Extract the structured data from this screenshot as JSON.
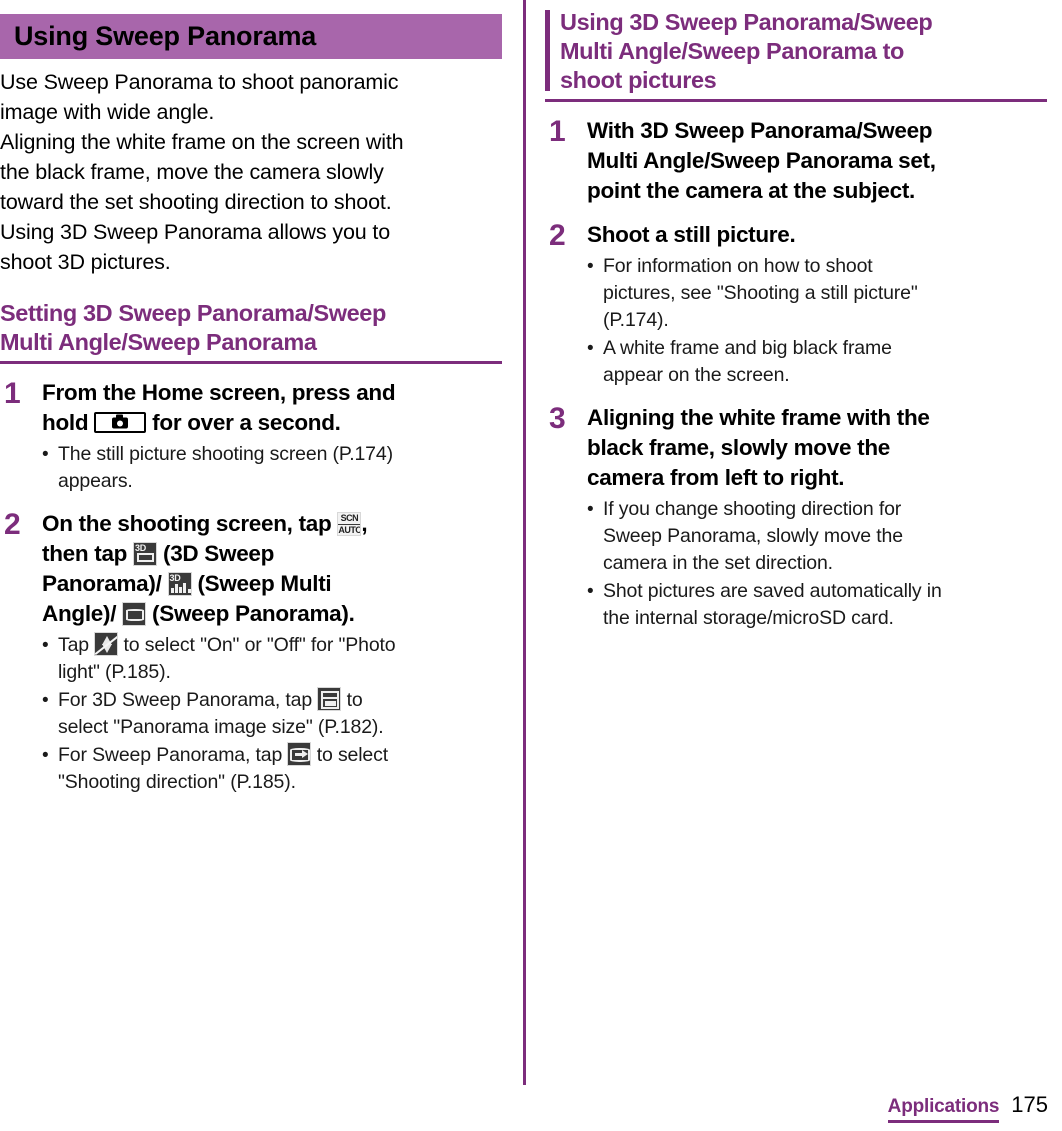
{
  "page": {
    "number": "175",
    "section_tag": "Applications"
  },
  "colors": {
    "header_bar": "#a866ab",
    "heading_purple": "#7c2d7c",
    "text": "#000000"
  },
  "left_column": {
    "title_bar": {
      "label": "Using Sweep Panorama"
    },
    "intro_paragraph": [
      "Use Sweep Panorama to shoot panoramic",
      "image with wide angle.",
      "Aligning the white frame on the screen with",
      "the black frame, move the camera slowly",
      "toward the set shooting direction to shoot.",
      "Using 3D Sweep Panorama allows you to",
      "shoot 3D pictures."
    ],
    "sub_heading": [
      "Setting 3D Sweep Panorama/Sweep",
      "Multi Angle/Sweep Panorama"
    ],
    "steps": [
      {
        "number": "1",
        "title_parts": [
          {
            "type": "text",
            "value": "From the Home screen, press and"
          },
          {
            "type": "break"
          },
          {
            "type": "text",
            "value": "hold "
          },
          {
            "type": "icon",
            "icon": "camera-key-icon"
          },
          {
            "type": "text",
            "value": " for over a second."
          }
        ],
        "bullets": [
          {
            "parts": [
              {
                "type": "text",
                "value": "The still picture shooting screen (P.174)"
              },
              {
                "type": "break"
              },
              {
                "type": "text",
                "value": "appears."
              }
            ]
          }
        ]
      },
      {
        "number": "2",
        "title_parts": [
          {
            "type": "text",
            "value": "On the shooting screen, tap "
          },
          {
            "type": "icon",
            "icon": "scn-auto-icon"
          },
          {
            "type": "text",
            "value": ","
          },
          {
            "type": "break"
          },
          {
            "type": "text",
            "value": "then tap "
          },
          {
            "type": "icon",
            "icon": "3d-sweep-panorama-icon"
          },
          {
            "type": "text",
            "value": " (3D Sweep"
          },
          {
            "type": "break"
          },
          {
            "type": "text",
            "value": "Panorama)/ "
          },
          {
            "type": "icon",
            "icon": "sweep-multi-angle-icon"
          },
          {
            "type": "text",
            "value": " (Sweep Multi"
          },
          {
            "type": "break"
          },
          {
            "type": "text",
            "value": "Angle)/ "
          },
          {
            "type": "icon",
            "icon": "sweep-panorama-icon"
          },
          {
            "type": "text",
            "value": " (Sweep Panorama)."
          }
        ],
        "bullets": [
          {
            "parts": [
              {
                "type": "text",
                "value": "Tap "
              },
              {
                "type": "icon",
                "icon": "photo-light-icon"
              },
              {
                "type": "text",
                "value": " to select \"On\" or \"Off\" for \"Photo"
              },
              {
                "type": "break"
              },
              {
                "type": "text",
                "value": "light\" (P.185)."
              }
            ]
          },
          {
            "parts": [
              {
                "type": "text",
                "value": "For 3D Sweep Panorama, tap "
              },
              {
                "type": "icon",
                "icon": "panorama-image-size-icon"
              },
              {
                "type": "text",
                "value": " to"
              },
              {
                "type": "break"
              },
              {
                "type": "text",
                "value": "select \"Panorama image size\" (P.182)."
              }
            ]
          },
          {
            "parts": [
              {
                "type": "text",
                "value": "For Sweep Panorama, tap "
              },
              {
                "type": "icon",
                "icon": "shooting-direction-icon"
              },
              {
                "type": "text",
                "value": " to select"
              },
              {
                "type": "break"
              },
              {
                "type": "text",
                "value": "\"Shooting direction\" (P.185)."
              }
            ]
          }
        ]
      }
    ]
  },
  "right_column": {
    "heading": [
      "Using 3D Sweep Panorama/Sweep",
      "Multi Angle/Sweep Panorama to",
      "shoot pictures"
    ],
    "steps": [
      {
        "number": "1",
        "title_lines": [
          "With 3D Sweep Panorama/Sweep",
          "Multi Angle/Sweep Panorama set,",
          "point the camera at the subject."
        ],
        "bullets": []
      },
      {
        "number": "2",
        "title_lines": [
          "Shoot a still picture."
        ],
        "bullets": [
          [
            "For information on how to shoot",
            "pictures, see \"Shooting a still picture\"",
            "(P.174)."
          ],
          [
            "A white frame and big black frame",
            "appear on the screen."
          ]
        ]
      },
      {
        "number": "3",
        "title_lines": [
          "Aligning the white frame with the",
          "black frame, slowly move the",
          "camera from left to right."
        ],
        "bullets": [
          [
            "If you change shooting direction for",
            "Sweep Panorama, slowly move the",
            "camera in the set direction."
          ],
          [
            "Shot pictures are saved automatically in",
            "the internal storage/microSD card."
          ]
        ]
      }
    ]
  },
  "icon_labels": {
    "scn_auto_top": "SCN",
    "scn_auto_bottom": "AUTO",
    "three_d": "3D"
  }
}
